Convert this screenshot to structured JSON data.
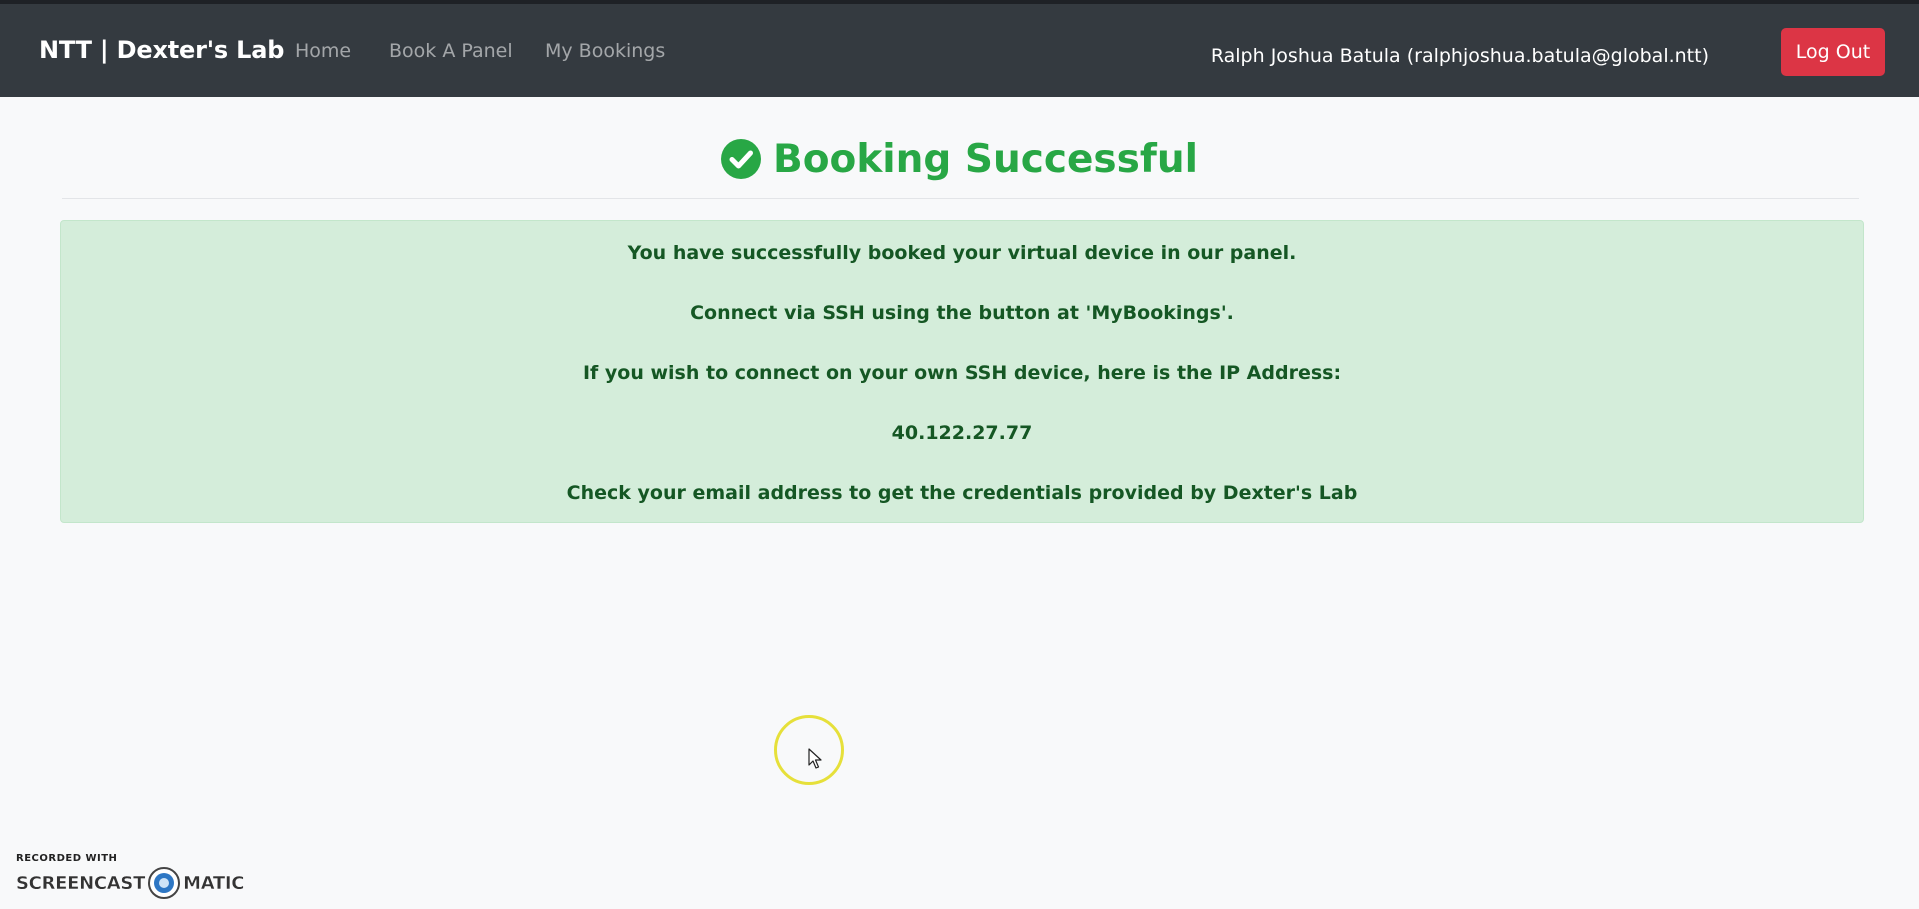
{
  "navbar": {
    "brand": "NTT | Dexter's Lab",
    "links": [
      "Home",
      "Book A Panel",
      "My Bookings"
    ],
    "user": "Ralph Joshua Batula (ralphjoshua.batula@global.ntt)",
    "logout_label": "Log Out"
  },
  "main": {
    "title": "Booking Successful",
    "title_icon": "check-circle-icon",
    "alert_lines": [
      "You have successfully booked your virtual device in our panel.",
      "Connect via SSH using the button at 'MyBookings'.",
      "If you wish to connect on your own SSH device, here is the IP Address:",
      "40.122.27.77",
      "Check your email address to get the credentials provided by Dexter's Lab"
    ]
  },
  "watermark": {
    "top": "RECORDED WITH",
    "left": "SCREENCAST",
    "right": "MATIC"
  },
  "colors": {
    "navbar": "#343a40",
    "success": "#28a745",
    "danger": "#dc3545",
    "alert_bg": "#d4edda",
    "alert_text": "#155724"
  }
}
